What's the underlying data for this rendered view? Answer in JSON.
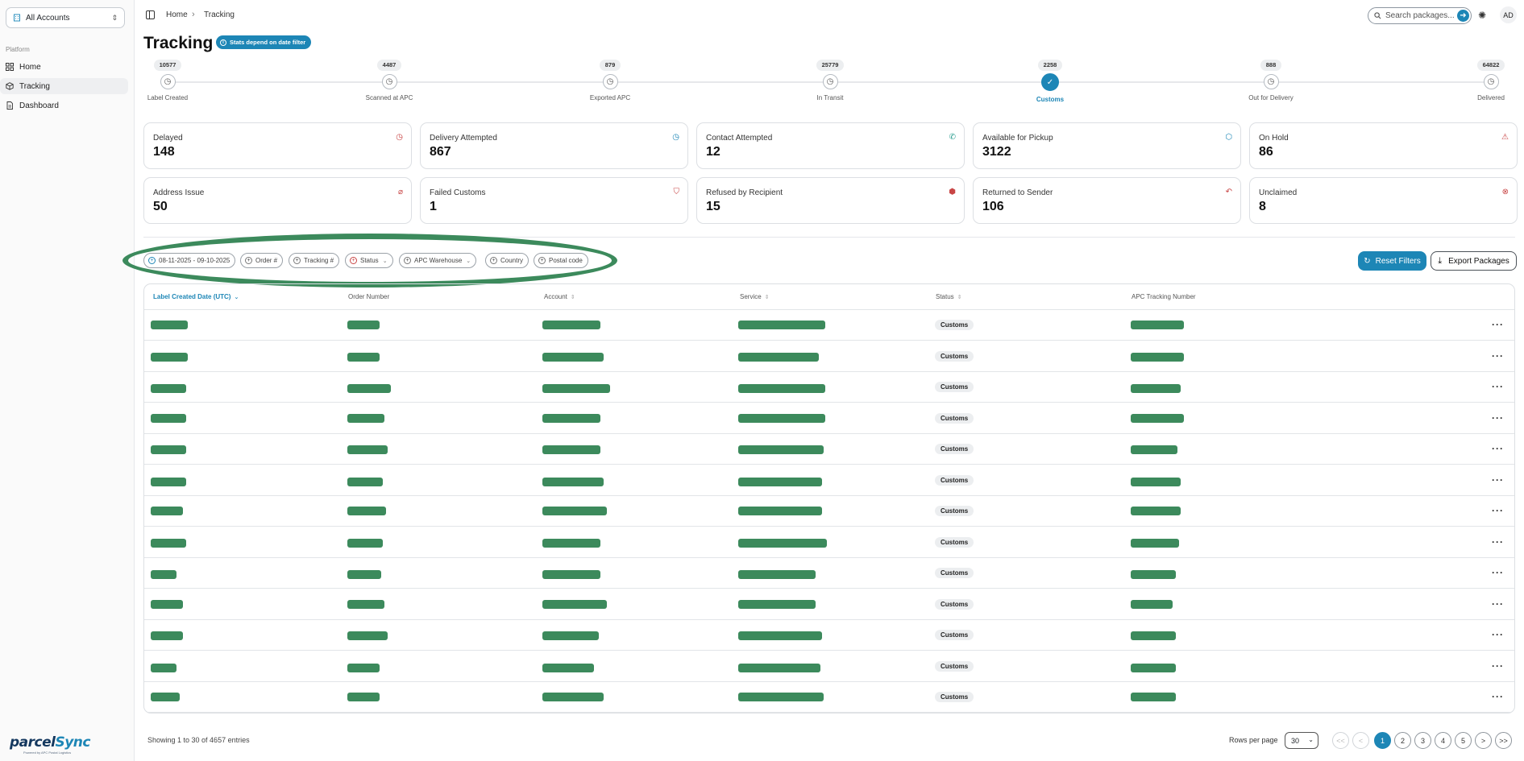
{
  "sidebar": {
    "account_select": "All Accounts",
    "section_label": "Platform",
    "items": [
      {
        "label": "Home",
        "active": false
      },
      {
        "label": "Tracking",
        "active": true
      },
      {
        "label": "Dashboard",
        "active": false
      }
    ],
    "logo_text_a": "parcel",
    "logo_text_b": "Sync",
    "logo_tagline": "Powered by APC Postal Logistics"
  },
  "topbar": {
    "breadcrumb": [
      "Home",
      "Tracking"
    ],
    "search_placeholder": "Search packages...",
    "avatar_initials": "AD"
  },
  "header": {
    "title": "Tracking",
    "stats_badge": "Stats depend on date filter"
  },
  "stepper": [
    {
      "count": "10577",
      "label": "Label Created",
      "active": false
    },
    {
      "count": "4487",
      "label": "Scanned at APC",
      "active": false
    },
    {
      "count": "879",
      "label": "Exported APC",
      "active": false
    },
    {
      "count": "25779",
      "label": "In Transit",
      "active": false
    },
    {
      "count": "2258",
      "label": "Customs",
      "active": true
    },
    {
      "count": "888",
      "label": "Out for Delivery",
      "active": false
    },
    {
      "count": "64822",
      "label": "Delivered",
      "active": false
    }
  ],
  "stat_cards": [
    {
      "label": "Delayed",
      "value": "148",
      "icon": "clock-icon",
      "color": "#c84545"
    },
    {
      "label": "Delivery Attempted",
      "value": "867",
      "icon": "clock-icon",
      "color": "#1d86b6"
    },
    {
      "label": "Contact Attempted",
      "value": "12",
      "icon": "phone-icon",
      "color": "#2a9d8f"
    },
    {
      "label": "Available for Pickup",
      "value": "3122",
      "icon": "package-icon",
      "color": "#1d86b6"
    },
    {
      "label": "On Hold",
      "value": "86",
      "icon": "alert-icon",
      "color": "#c84545"
    },
    {
      "label": "Address Issue",
      "value": "50",
      "icon": "map-pin-off-icon",
      "color": "#c84545"
    },
    {
      "label": "Failed Customs",
      "value": "1",
      "icon": "shield-alert-icon",
      "color": "#c84545"
    },
    {
      "label": "Refused by Recipient",
      "value": "15",
      "icon": "package-x-icon",
      "color": "#c84545"
    },
    {
      "label": "Returned to Sender",
      "value": "106",
      "icon": "undo-icon",
      "color": "#c84545"
    },
    {
      "label": "Unclaimed",
      "value": "8",
      "icon": "x-circle-icon",
      "color": "#c84545"
    }
  ],
  "filters": {
    "chips": [
      {
        "label": "08-11-2025 - 09-10-2025",
        "type": "date"
      },
      {
        "label": "Order #",
        "type": "text"
      },
      {
        "label": "Tracking #",
        "type": "text"
      },
      {
        "label": "Status",
        "type": "status"
      },
      {
        "label": "APC Warehouse",
        "type": "select"
      },
      {
        "label": "Country",
        "type": "text"
      },
      {
        "label": "Postal code",
        "type": "text"
      }
    ],
    "reset_label": "Reset Filters",
    "export_label": "Export Packages"
  },
  "table": {
    "columns": [
      "Label Created Date (UTC)",
      "Order Number",
      "Account",
      "Service",
      "Status",
      "APC Tracking Number"
    ],
    "row_status": "Customs",
    "row_count": 13
  },
  "footer": {
    "entries_text": "Showing 1 to 30 of 4657 entries",
    "rows_per_page_label": "Rows per page",
    "rows_per_page_value": "30",
    "pages": [
      "1",
      "2",
      "3",
      "4",
      "5"
    ],
    "first": "<<",
    "prev": "<",
    "next": ">",
    "last": ">>"
  },
  "colors": {
    "accent": "#1d86b6",
    "redaction": "#3c8a5c"
  }
}
